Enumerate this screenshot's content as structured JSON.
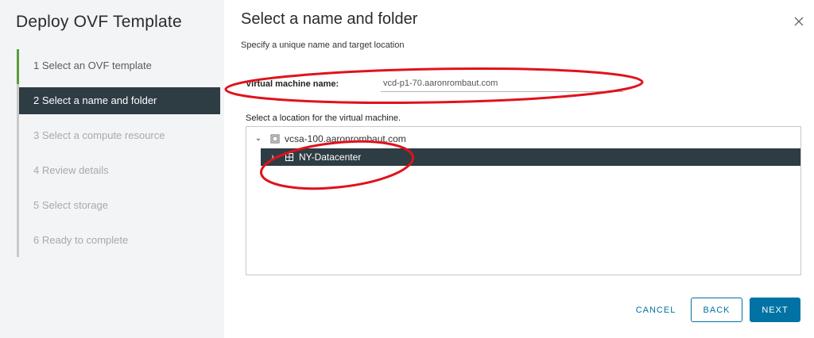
{
  "wizard": {
    "title": "Deploy OVF Template",
    "steps": [
      {
        "label": "1  Select an OVF template",
        "state": "completed"
      },
      {
        "label": "2  Select a name and folder",
        "state": "active"
      },
      {
        "label": "3  Select a compute resource",
        "state": "pending"
      },
      {
        "label": "4  Review details",
        "state": "pending"
      },
      {
        "label": "5  Select storage",
        "state": "pending"
      },
      {
        "label": "6  Ready to complete",
        "state": "pending"
      }
    ]
  },
  "main": {
    "title": "Select a name and folder",
    "subtitle": "Specify a unique name and target location",
    "vm_name_label": "Virtual machine name:",
    "vm_name_value": "vcd-p1-70.aaronrombaut.com",
    "location_label": "Select a location for the virtual machine.",
    "tree": {
      "root": {
        "label": "vcsa-100.aaronrombaut.com",
        "icon": "vcenter-icon",
        "expanded": true
      },
      "child": {
        "label": "NY-Datacenter",
        "icon": "datacenter-icon",
        "expanded": false,
        "selected": true
      }
    }
  },
  "footer": {
    "cancel_label": "CANCEL",
    "back_label": "BACK",
    "next_label": "NEXT"
  },
  "colors": {
    "active_step_bg": "#2e3c44",
    "completed_bar": "#5a9e3a",
    "primary": "#0072a3",
    "annotation": "#e0121b"
  }
}
